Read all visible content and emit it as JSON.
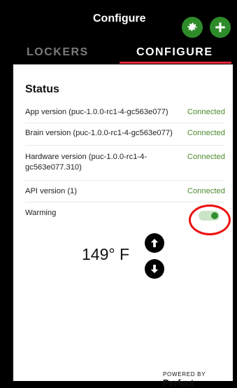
{
  "header": {
    "title": "Configure",
    "actions": [
      {
        "icon": "gear-icon"
      },
      {
        "icon": "plus-icon"
      }
    ]
  },
  "tabs": [
    {
      "label": "LOCKERS",
      "active": false
    },
    {
      "label": "CONFIGURE",
      "active": true
    }
  ],
  "status": {
    "title": "Status",
    "rows": [
      {
        "label": "App version (puc-1.0.0-rc1-4-gc563e077)",
        "value": "Connected"
      },
      {
        "label": "Brain version (puc-1.0.0-rc1-4-gc563e077)",
        "value": "Connected"
      },
      {
        "label": "Hardware version (puc-1.0.0-rc1-4-gc563e077.310)",
        "value": "Connected"
      },
      {
        "label": "API version (1)",
        "value": "Connected"
      }
    ],
    "warming": {
      "label": "Warming",
      "enabled": true
    }
  },
  "temperature": {
    "value": "149° F"
  },
  "footer": {
    "powered_by": "POWERED BY",
    "brand": "Perfect"
  },
  "colors": {
    "accent_green": "#2e8b2a",
    "tab_underline": "#e32636",
    "highlight_ring": "#e11111"
  }
}
